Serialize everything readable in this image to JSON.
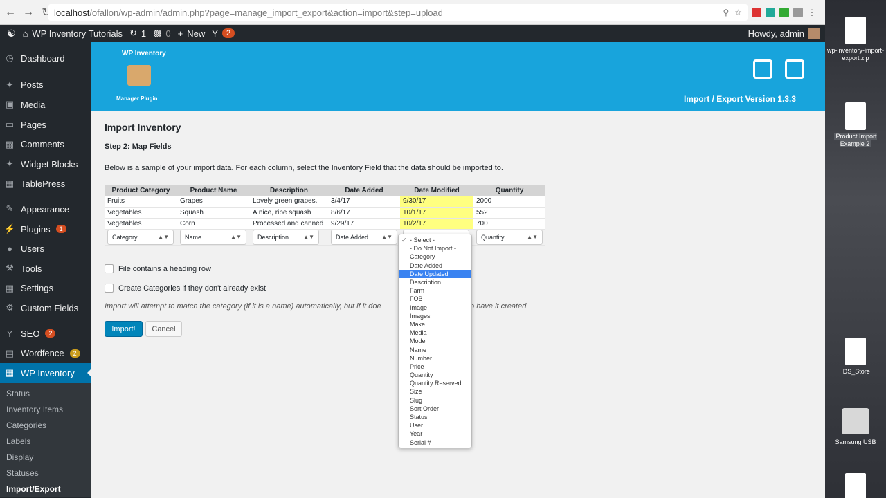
{
  "browser": {
    "url_host": "localhost",
    "url_path": "/ofallon/wp-admin/admin.php?page=manage_import_export&action=import&step=upload"
  },
  "adminbar": {
    "site_name": "WP Inventory Tutorials",
    "updates_count": "1",
    "comments_count": "0",
    "new_label": "New",
    "yoast_count": "2",
    "howdy": "Howdy, admin"
  },
  "sidebar": {
    "items": [
      {
        "label": "Dashboard"
      },
      {
        "label": "Posts"
      },
      {
        "label": "Media"
      },
      {
        "label": "Pages"
      },
      {
        "label": "Comments"
      },
      {
        "label": "Widget Blocks"
      },
      {
        "label": "TablePress"
      },
      {
        "label": "Appearance"
      },
      {
        "label": "Plugins",
        "badge": "1"
      },
      {
        "label": "Users"
      },
      {
        "label": "Tools"
      },
      {
        "label": "Settings"
      },
      {
        "label": "Custom Fields"
      },
      {
        "label": "SEO",
        "badge": "2"
      },
      {
        "label": "Wordfence",
        "badge": "2"
      },
      {
        "label": "WP Inventory"
      }
    ],
    "submenu": [
      "Status",
      "Inventory Items",
      "Categories",
      "Labels",
      "Display",
      "Statuses",
      "Import/Export"
    ]
  },
  "banner": {
    "logo_top": "WP Inventory",
    "logo_bottom": "Manager Plugin",
    "version": "Import / Export Version 1.3.3"
  },
  "page": {
    "title": "Import Inventory",
    "step": "Step 2: Map Fields",
    "description": "Below is a sample of your import data. For each column, select the Inventory Field that the data should be imported to.",
    "headers": [
      "Product Category",
      "Product Name",
      "Description",
      "Date Added",
      "Date Modified",
      "Quantity"
    ],
    "rows": [
      [
        "Fruits",
        "Grapes",
        "Lovely green grapes.",
        "3/4/17",
        "9/30/17",
        "2000"
      ],
      [
        "Vegetables",
        "Squash",
        "A nice, ripe squash",
        "8/6/17",
        "10/1/17",
        "552"
      ],
      [
        "Vegetables",
        "Corn",
        "Processed and canned",
        "9/29/17",
        "10/2/17",
        "700"
      ]
    ],
    "selects": [
      "Category",
      "Name",
      "Description",
      "Date Added",
      "",
      "Quantity"
    ],
    "heading_row_label": "File contains a heading row",
    "create_categories_label": "Create Categories if they don't already exist",
    "note_left": "Import will attempt to match the category (if it is a name) automatically, but if it doe",
    "note_right": "can choose to have it created",
    "import_label": "Import!",
    "cancel_label": "Cancel"
  },
  "dropdown": {
    "options": [
      "- Select -",
      "- Do Not Import -",
      "Category",
      "Date Added",
      "Date Updated",
      "Description",
      "Farm",
      "FOB",
      "Image",
      "Images",
      "Make",
      "Media",
      "Model",
      "Name",
      "Number",
      "Price",
      "Quantity",
      "Quantity Reserved",
      "Size",
      "Slug",
      "Sort Order",
      "Status",
      "User",
      "Year",
      "Serial #"
    ],
    "checked_index": 0,
    "highlighted_index": 4
  },
  "desktop": {
    "items": [
      "wp-inventory-import-export.zip",
      "Product Import Example 2",
      ".DS_Store",
      "Samsung USB"
    ]
  },
  "colors": {
    "accent": "#0073aa",
    "banner": "#18a4dc",
    "highlight": "#ffff80"
  }
}
